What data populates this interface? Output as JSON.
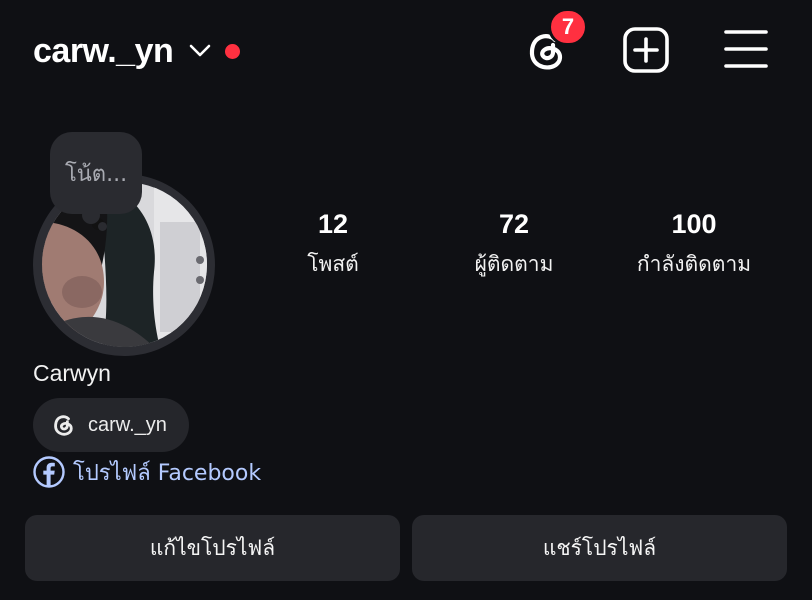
{
  "header": {
    "username": "carw._yn",
    "notification_count": "7",
    "icons": {
      "username_switch": "chevron-down-icon",
      "unread": "red-dot-indicator",
      "threads": "threads-icon",
      "create": "plus-square-icon",
      "menu": "hamburger-menu-icon"
    }
  },
  "profile": {
    "note_placeholder": "โน้ต...",
    "display_name": "Carwyn",
    "threads_handle": "carw._yn",
    "facebook_link": "โปรไฟล์ Facebook",
    "stats": [
      {
        "value": "12",
        "label": "โพสต์"
      },
      {
        "value": "72",
        "label": "ผู้ติดตาม"
      },
      {
        "value": "100",
        "label": "กำลังติดตาม"
      }
    ]
  },
  "actions": {
    "edit_profile": "แก้ไขโปรไฟล์",
    "share_profile": "แชร์โปรไฟล์"
  },
  "colors": {
    "background": "#0f1014",
    "badge_red": "#ff3040",
    "button_bg": "#26272c",
    "link_blue": "#b4caff"
  }
}
